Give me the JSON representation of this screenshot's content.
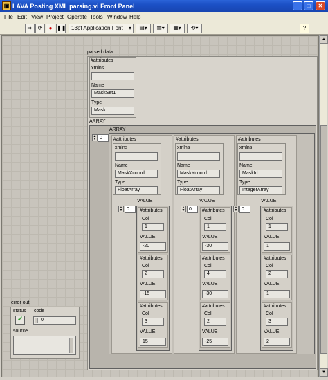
{
  "window": {
    "title": "LAVA Posting XML parsing.vi Front Panel",
    "min": "_",
    "max": "□",
    "close": "✕"
  },
  "menu": [
    "File",
    "Edit",
    "View",
    "Project",
    "Operate",
    "Tools",
    "Window",
    "Help"
  ],
  "toolbar": {
    "font": "13pt Application Font",
    "help": "?"
  },
  "parsed": {
    "label": "parsed data",
    "attributes_label": "#attributes",
    "xmlns_label": "xmlns",
    "xmlns_value": "",
    "name_label": "Name",
    "name_value": "MaskSet1",
    "type_label": "Type",
    "type_value": "Mask",
    "array_label": "ARRAY",
    "inner_array_label": "ARRAY",
    "index": "0",
    "columns": [
      {
        "attributes": "#attributes",
        "xmlns": "xmlns",
        "xmlns_value": "",
        "name_label": "Name",
        "name": "MaskXcoord",
        "type_label": "Type",
        "type": "FloatArray",
        "value_label": "VALUE",
        "index": "0",
        "rows": [
          {
            "attr": "#attributes",
            "col_label": "Col",
            "col": "1",
            "value_label": "VALUE",
            "value": "-20"
          },
          {
            "attr": "#attributes",
            "col_label": "Col",
            "col": "2",
            "value_label": "VALUE",
            "value": "-15"
          },
          {
            "attr": "#attributes",
            "col_label": "Col",
            "col": "3",
            "value_label": "VALUE",
            "value": "15"
          }
        ]
      },
      {
        "attributes": "#attributes",
        "xmlns": "xmlns",
        "xmlns_value": "",
        "name_label": "Name",
        "name": "MaskYcoord",
        "type_label": "Type",
        "type": "FloatArray",
        "value_label": "VALUE",
        "index": "0",
        "rows": [
          {
            "attr": "#attributes",
            "col_label": "Col",
            "col": "1",
            "value_label": "VALUE",
            "value": "-30"
          },
          {
            "attr": "#attributes",
            "col_label": "Col",
            "col": "4",
            "value_label": "VALUE",
            "value": "-30"
          },
          {
            "attr": "#attributes",
            "col_label": "Col",
            "col": "2",
            "value_label": "VALUE",
            "value": "-25"
          }
        ]
      },
      {
        "attributes": "#attributes",
        "xmlns": "xmlns",
        "xmlns_value": "",
        "name_label": "Name",
        "name": "MaskId",
        "type_label": "Type",
        "type": "IntegerArray",
        "value_label": "VALUE",
        "index": "0",
        "rows": [
          {
            "attr": "#attributes",
            "col_label": "Col",
            "col": "1",
            "value_label": "VALUE",
            "value": "1"
          },
          {
            "attr": "#attributes",
            "col_label": "Col",
            "col": "2",
            "value_label": "VALUE",
            "value": "1"
          },
          {
            "attr": "#attributes",
            "col_label": "Col",
            "col": "3",
            "value_label": "VALUE",
            "value": "2"
          }
        ]
      }
    ]
  },
  "error_out": {
    "label": "error out",
    "status_label": "status",
    "code_label": "code",
    "code_value": "0",
    "status_icon": "check-icon",
    "source_label": "source",
    "source_value": ""
  },
  "colors": {
    "titlebar": "#1b4fc4",
    "panel": "#c8c4bc",
    "status_ok": "#2a9a2a"
  }
}
